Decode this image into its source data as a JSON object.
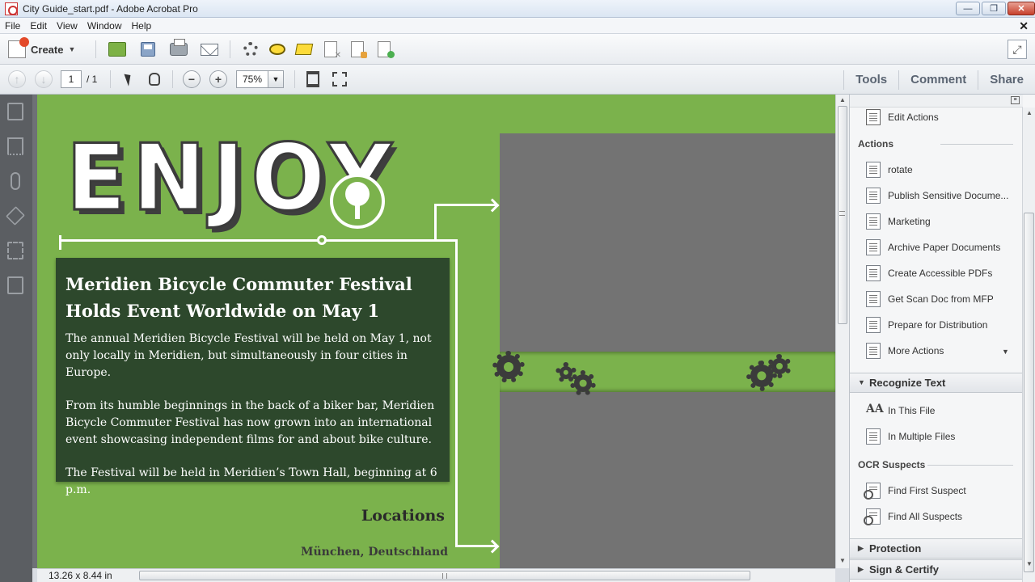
{
  "window": {
    "title": "City Guide_start.pdf - Adobe Acrobat Pro",
    "buttons": {
      "minimize": "—",
      "maximize": "❐",
      "close": "✕"
    }
  },
  "menu": {
    "items": [
      "File",
      "Edit",
      "View",
      "Window",
      "Help"
    ],
    "doc_close": "✕"
  },
  "toolbar": {
    "create_label": "Create",
    "icons": [
      "open-folder-icon",
      "save-icon",
      "print-icon",
      "email-icon",
      "settings-gear-icon",
      "comment-bubble-icon",
      "highlight-icon",
      "delete-doc-icon",
      "edit-doc-icon",
      "export-doc-icon",
      "expand-icon"
    ]
  },
  "nav": {
    "page_current": "1",
    "page_total": "/ 1",
    "zoom": "75%",
    "tabs": [
      "Tools",
      "Comment",
      "Share"
    ]
  },
  "document": {
    "headline_word": "ENJOY",
    "box_title": "Meridien Bicycle Commuter Festival Holds Event Worldwide on May 1",
    "paragraphs": [
      "The annual Meridien Bicycle Festival will be held on May 1, not only locally in Meridien, but simultaneously in four cities in Europe.",
      "From its humble beginnings in the back of a biker bar, Meridien Bicycle Commuter Festival has now grown into an international event showcasing independent films for and about bike culture.",
      "The Festival will be held in Meridien’s Town Hall, beginning at 6 p.m."
    ],
    "locations_heading": "Locations",
    "cities": [
      "München, Deutschland"
    ],
    "colors": {
      "background": "#7bb24c",
      "box": "#2d482c",
      "photo_placeholder": "#737373"
    }
  },
  "status": {
    "page_size": "13.26 x 8.44 in"
  },
  "panel": {
    "top_item": "Edit Actions",
    "actions_label": "Actions",
    "actions": [
      "rotate",
      "Publish Sensitive Docume...",
      "Marketing",
      "Archive Paper Documents",
      "Create Accessible PDFs",
      "Get Scan Doc from MFP",
      "Prepare for Distribution",
      "More Actions"
    ],
    "recognize_text": {
      "header": "Recognize Text",
      "items": [
        "In This File",
        "In Multiple Files"
      ],
      "ocr_label": "OCR Suspects",
      "ocr_items": [
        "Find First Suspect",
        "Find All Suspects"
      ]
    },
    "protection": "Protection",
    "sign_certify": "Sign & Certify"
  }
}
